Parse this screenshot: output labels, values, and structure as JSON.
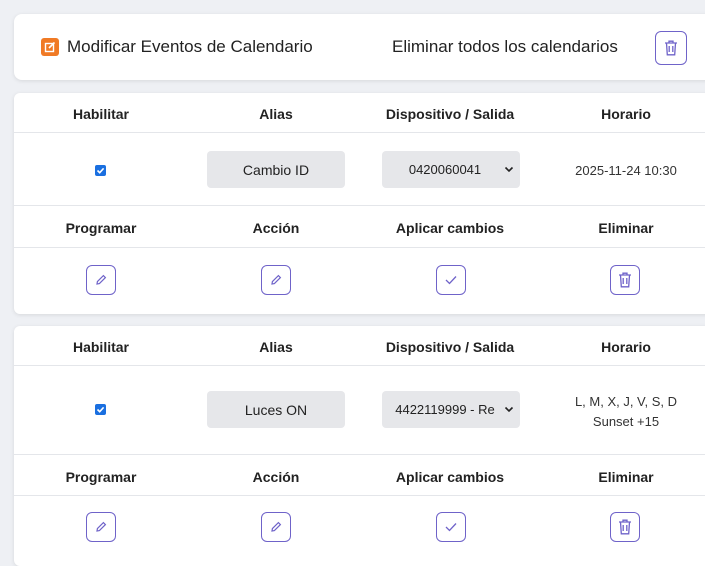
{
  "header": {
    "title": "Modificar Eventos de Calendario",
    "delete_all_label": "Eliminar todos los calendarios",
    "edit_icon": "edit-square-icon",
    "trash_icon": "trash-icon"
  },
  "columns": {
    "enable": "Habilitar",
    "alias": "Alias",
    "device": "Dispositivo / Salida",
    "schedule": "Horario",
    "program": "Programar",
    "action": "Acción",
    "apply": "Aplicar cambios",
    "delete": "Eliminar"
  },
  "events": [
    {
      "enabled": true,
      "alias": "Cambio ID",
      "device": "0420060041",
      "schedule_line1": "2025-11-24 10:30",
      "schedule_line2": ""
    },
    {
      "enabled": true,
      "alias": "Luces ON",
      "device": "4422119999 - Re",
      "schedule_line1": "L, M, X, J, V, S, D",
      "schedule_line2": "Sunset +15"
    }
  ],
  "colors": {
    "accent": "#6f63c9",
    "badge": "#f07a25",
    "checkbox": "#1a6fe0"
  }
}
